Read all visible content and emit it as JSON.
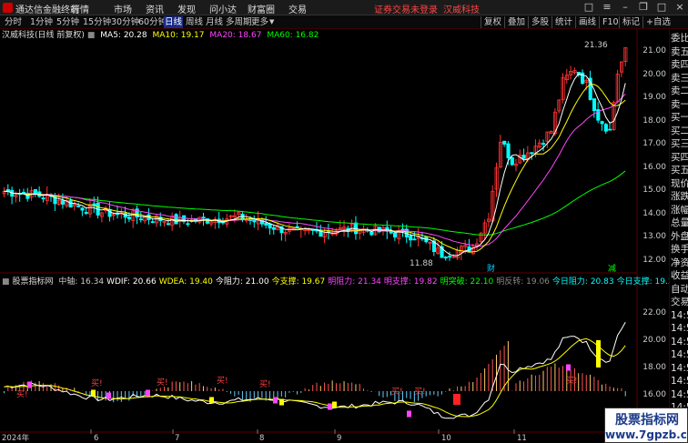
{
  "titlebar": {
    "app_title": "通达信金融终端",
    "menus": [
      "行情",
      "市场",
      "资讯",
      "发现",
      "问小达",
      "财富圈",
      "交易"
    ],
    "warning": "证券交易未登录",
    "stock_tab": "汉威科技"
  },
  "toolbar": {
    "periods": [
      "分时",
      "1分钟",
      "5分钟",
      "15分钟",
      "30分钟",
      "60分钟",
      "日线",
      "周线",
      "月线",
      "多周期",
      "更多"
    ],
    "active_period": "日线",
    "right_buttons": [
      "复权",
      "叠加",
      "多股",
      "统计",
      "画线",
      "F10",
      "标记",
      "+自选"
    ]
  },
  "main_chart": {
    "stock_label": "汉威科技(日线 前复权)",
    "ma_labels": [
      {
        "text": "MA5: 20.28",
        "color": "#ffffff"
      },
      {
        "text": "MA10: 19.17",
        "color": "#ffff00"
      },
      {
        "text": "MA20: 18.67",
        "color": "#ff44ff"
      },
      {
        "text": "MA60: 16.82",
        "color": "#00ff00"
      }
    ],
    "high_label": "21.36",
    "low_label": "11.88",
    "price_axis": [
      "21.00",
      "20.00",
      "19.00",
      "18.00",
      "17.00",
      "16.00",
      "15.00",
      "14.00",
      "13.00",
      "12.00"
    ],
    "marker_cai": "财",
    "marker_jian": "减"
  },
  "indicator": {
    "name_label": "股票指标网",
    "values": [
      {
        "text": "中轴: 16.34",
        "color": "#cccccc"
      },
      {
        "text": "WDIF: 20.66",
        "color": "#ffffff"
      },
      {
        "text": "WDEA: 19.40",
        "color": "#ffff00"
      },
      {
        "text": "今阻力: 21.00",
        "color": "#ffffff"
      },
      {
        "text": "今支撑: 19.67",
        "color": "#ffff00"
      },
      {
        "text": "明阻力: 21.34",
        "color": "#ff44ff"
      },
      {
        "text": "明支撑: 19.82",
        "color": "#ff44ff"
      },
      {
        "text": "明突破: 22.10",
        "color": "#00ff00"
      },
      {
        "text": "明反转: 19.06",
        "color": "#888888"
      },
      {
        "text": "今日阻力: 20.83",
        "color": "#00ffff"
      },
      {
        "text": "今日支撑: 19.37",
        "color": "#00ffff"
      }
    ],
    "axis": [
      "22.00",
      "20.00",
      "18.00",
      "16.00",
      "14.00"
    ],
    "buy_label": "买!"
  },
  "dates": [
    "2024年",
    "6",
    "7",
    "8",
    "9",
    "10",
    "11"
  ],
  "sidebar": [
    "委比",
    "卖五",
    "卖四",
    "卖三",
    "卖二",
    "卖一",
    "买一",
    "买二",
    "买三",
    "买四",
    "买五",
    "现价",
    "涨跌",
    "涨幅",
    "总量",
    "外盘",
    "换手",
    "净资",
    "收益",
    "自动",
    "交易",
    "14:5",
    "14:5",
    "14:5",
    "14:5",
    "14:5",
    "14:5",
    "14:5",
    "14:5"
  ],
  "watermark": {
    "line1": "股票指标网",
    "line2": "www.7gpzb.com"
  },
  "colors": {
    "up": "#ff3333",
    "down": "#00ffff",
    "ma5": "#ffffff",
    "ma10": "#ffff00",
    "ma20": "#ff44ff",
    "ma60": "#00ff00"
  }
}
